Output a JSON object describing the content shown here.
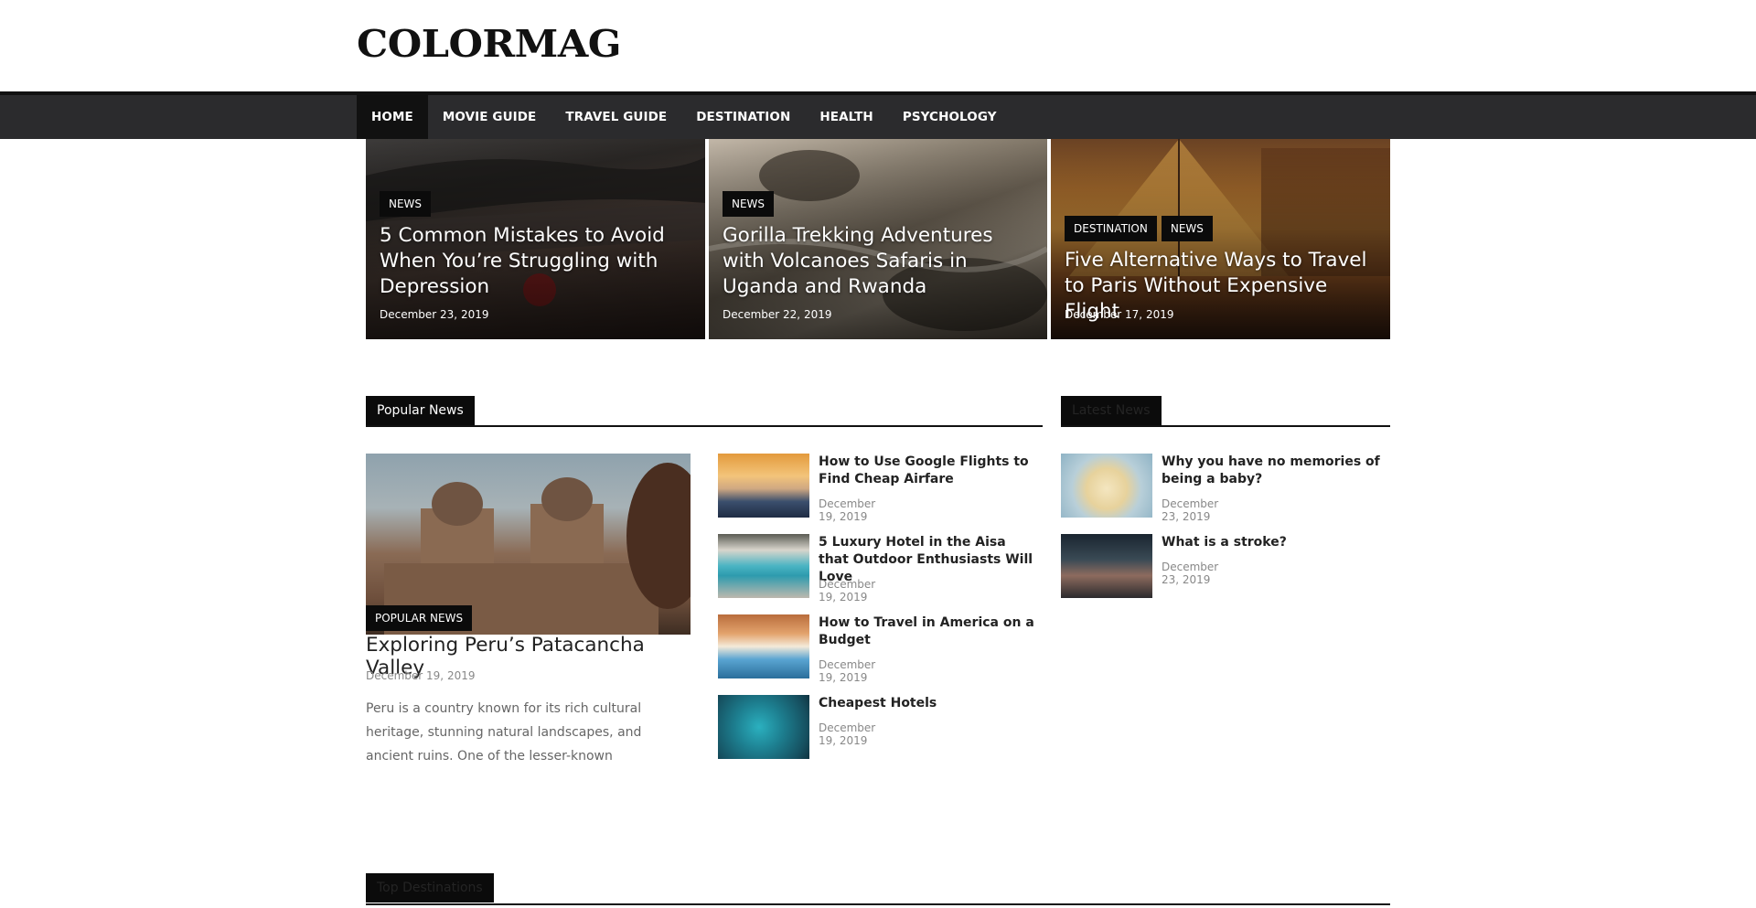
{
  "site": {
    "logo": "COLORMAG"
  },
  "nav": {
    "items": [
      {
        "label": "HOME"
      },
      {
        "label": "MOVIE GUIDE"
      },
      {
        "label": "TRAVEL GUIDE"
      },
      {
        "label": "DESTINATION"
      },
      {
        "label": "HEALTH"
      },
      {
        "label": "PSYCHOLOGY"
      }
    ]
  },
  "featured": [
    {
      "categories": [
        "NEWS"
      ],
      "title": "5 Common Mistakes to Avoid When You’re Struggling with Depression",
      "date": "December 23, 2019"
    },
    {
      "categories": [
        "NEWS"
      ],
      "title": "Gorilla Trekking Adventures with Volcanoes Safaris in Uganda and Rwanda",
      "date": "December 22, 2019"
    },
    {
      "categories": [
        "DESTINATION",
        "NEWS"
      ],
      "title": "Five Alternative Ways to Travel to Paris Without Expensive Flight",
      "date": "December 17, 2019"
    }
  ],
  "popular": {
    "heading": "Popular News",
    "main": {
      "category": "POPULAR NEWS",
      "title": "Exploring Peru’s Patacancha Valley",
      "date": "December 19, 2019",
      "excerpt": "Peru is a country known for its rich cultural heritage, stunning natural landscapes, and ancient ruins. One of the lesser-known"
    },
    "list": [
      {
        "title": "How to Use Google Flights to Find Cheap Airfare",
        "date": "December 19, 2019"
      },
      {
        "title": "5 Luxury Hotel in the Aisa that Outdoor Enthusiasts Will Love",
        "date": "December 19, 2019"
      },
      {
        "title": "How to Travel in America on a Budget",
        "date": "December 19, 2019"
      },
      {
        "title": "Cheapest Hotels",
        "date": "December 19, 2019"
      }
    ]
  },
  "latest": {
    "heading": "Latest News",
    "list": [
      {
        "title": "Why you have no memories of being a baby?",
        "date": "December 23, 2019"
      },
      {
        "title": "What is a stroke?",
        "date": "December 23, 2019"
      }
    ]
  },
  "top_destinations": {
    "heading": "Top Destinations"
  }
}
